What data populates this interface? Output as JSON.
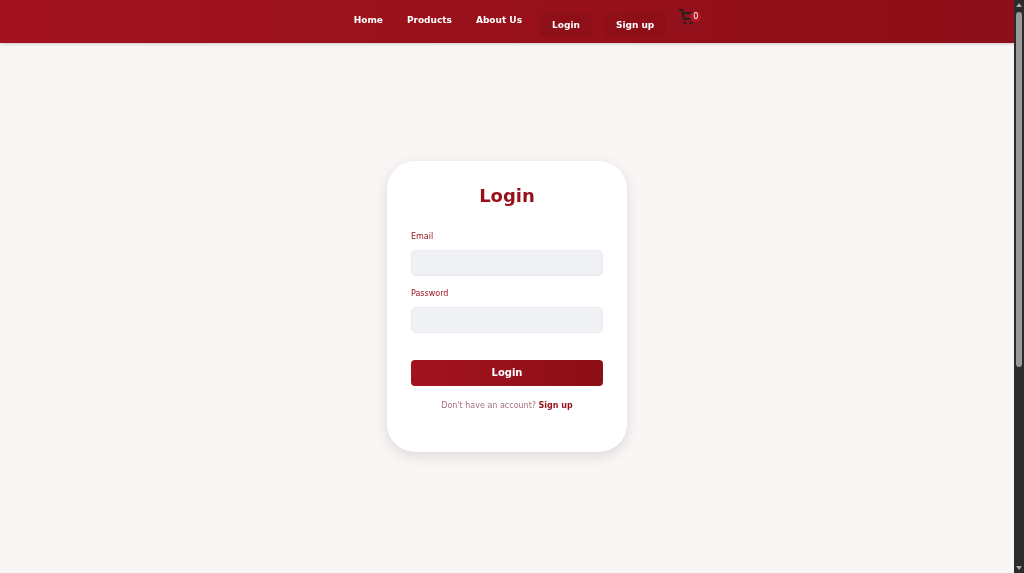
{
  "nav": {
    "links": [
      "Home",
      "Products",
      "About Us"
    ],
    "buttons": [
      "Login",
      "Sign up"
    ],
    "cart_count": "0"
  },
  "login": {
    "title": "Login",
    "fields": [
      {
        "label": "Email"
      },
      {
        "label": "Password"
      }
    ],
    "submit": "Login",
    "prompt": "Don't have an account?",
    "link": "Sign up"
  }
}
